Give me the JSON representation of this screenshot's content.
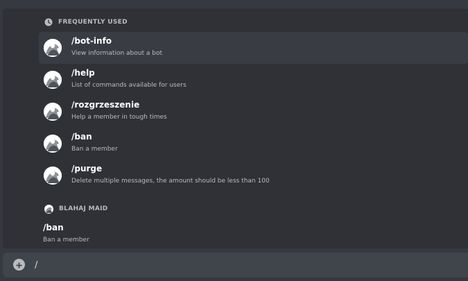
{
  "rail": {
    "items": [
      {
        "name": "frequently-used-tab-icon"
      },
      {
        "name": "bot-avatar-tab"
      },
      {
        "name": "pencil-icon"
      }
    ]
  },
  "frequent": {
    "header": "FREQUENTLY USED",
    "commands": [
      {
        "name": "/bot-info",
        "desc": "View information about a bot"
      },
      {
        "name": "/help",
        "desc": "List of commands available for users"
      },
      {
        "name": "/rozgrzeszenie",
        "desc": "Help a member in tough times"
      },
      {
        "name": "/ban",
        "desc": "Ban a member"
      },
      {
        "name": "/purge",
        "desc": "Delete multiple messages, the amount should be less than 100"
      }
    ]
  },
  "bot_section": {
    "header": "BLAHAJ MAID",
    "commands": [
      {
        "name": "/ban",
        "desc": "Ban a member"
      }
    ]
  },
  "chatbar": {
    "value": "/"
  },
  "colors": {
    "background": "#36393f",
    "popup": "#2f3136",
    "rail": "#202225",
    "selected_row": "#393c43",
    "input": "#40444b"
  }
}
